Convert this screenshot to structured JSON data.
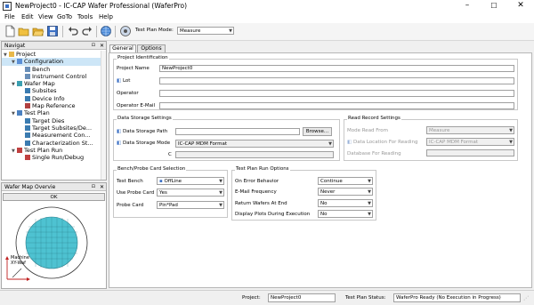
{
  "window": {
    "title": "NewProject0 - IC-CAP Wafer Professional (WaferPro)",
    "minimize": "–",
    "maximize": "☐",
    "close": "✕"
  },
  "menu": [
    "File",
    "Edit",
    "View",
    "GoTo",
    "Tools",
    "Help"
  ],
  "toolbar": {
    "test_plan_mode_label": "Test Plan Mode:",
    "test_plan_mode_value": "Measure"
  },
  "navigator": {
    "title": "Navigat",
    "items": [
      {
        "label": "Project",
        "icon": "folder-icon",
        "color": "#e8b84a"
      },
      {
        "label": "Configuration",
        "icon": "gear-icon",
        "color": "#5b8fd6"
      },
      {
        "label": "Bench",
        "icon": "bench-icon",
        "color": "#6a8fb8"
      },
      {
        "label": "Instrument Control",
        "icon": "instrument-icon",
        "color": "#6a8fb8"
      },
      {
        "label": "Wafer Map",
        "icon": "wafer-icon",
        "color": "#3b9fb0"
      },
      {
        "label": "Subsites",
        "icon": "grid-icon",
        "color": "#3b7bb0"
      },
      {
        "label": "Device Info",
        "icon": "device-icon",
        "color": "#3b7bb0"
      },
      {
        "label": "Map Reference",
        "icon": "reference-icon",
        "color": "#b04040"
      },
      {
        "label": "Test Plan",
        "icon": "plan-icon",
        "color": "#4a80c0"
      },
      {
        "label": "Target Dies",
        "icon": "dies-icon",
        "color": "#3b7bb0"
      },
      {
        "label": "Target Subsites/De...",
        "icon": "subsites-icon",
        "color": "#3b7bb0"
      },
      {
        "label": "Measurement Con...",
        "icon": "measure-icon",
        "color": "#3b7bb0"
      },
      {
        "label": "Characterization St...",
        "icon": "chart-icon",
        "color": "#3b7bb0"
      },
      {
        "label": "Test Plan Run",
        "icon": "run-icon",
        "color": "#c04040"
      },
      {
        "label": "Single Run/Debug",
        "icon": "debug-icon",
        "color": "#c04040"
      }
    ]
  },
  "wafer_overview": {
    "title": "Wafer Map Overvie",
    "ok_label": "OK",
    "axis_label_line1": "Machine",
    "axis_label_line2": "XY-Waf"
  },
  "tabs": [
    {
      "label": "General"
    },
    {
      "label": "Options"
    }
  ],
  "project_identification": {
    "title": "Project Identification",
    "fields": [
      {
        "label": "Project Name",
        "value": "NewProject0"
      },
      {
        "label": "Lot",
        "value": ""
      },
      {
        "label": "Operator",
        "value": ""
      },
      {
        "label": "Operator E-Mail",
        "value": ""
      }
    ]
  },
  "data_storage": {
    "title": "Data Storage Settings",
    "path_label": "Data Storage Path",
    "path_value": "",
    "browse_label": "Browse...",
    "mode_label": "Data Storage Mode",
    "mode_value": "IC-CAP MDM Format",
    "extra_label": "C"
  },
  "read_record": {
    "title": "Read Record Settings",
    "mode_label": "Mode Read From",
    "mode_value": "Measure",
    "location_label": "Data Location For Reading",
    "location_value": "IC-CAP MDM Format",
    "database_label": "Database For Reading",
    "database_value": ""
  },
  "bench_probe": {
    "title": "Bench/Probe Card Selection",
    "rows": [
      {
        "label": "Test Bench",
        "value": "OffLine"
      },
      {
        "label": "Use Probe Card",
        "value": "Yes"
      },
      {
        "label": "Probe Card",
        "value": "Pin*Pad"
      }
    ]
  },
  "run_options": {
    "title": "Test Plan Run Options",
    "rows": [
      {
        "label": "On Error Behavior",
        "value": "Continue"
      },
      {
        "label": "E-Mail Frequency",
        "value": "Never"
      },
      {
        "label": "Return Wafers At End",
        "value": "No"
      },
      {
        "label": "Display Plots During Execution",
        "value": "No"
      }
    ]
  },
  "status": {
    "project_label": "Project:",
    "project_value": "NewProject0",
    "status_label": "Test Plan Status:",
    "status_value": "WaferPro Ready (No Execution in Progress)"
  }
}
